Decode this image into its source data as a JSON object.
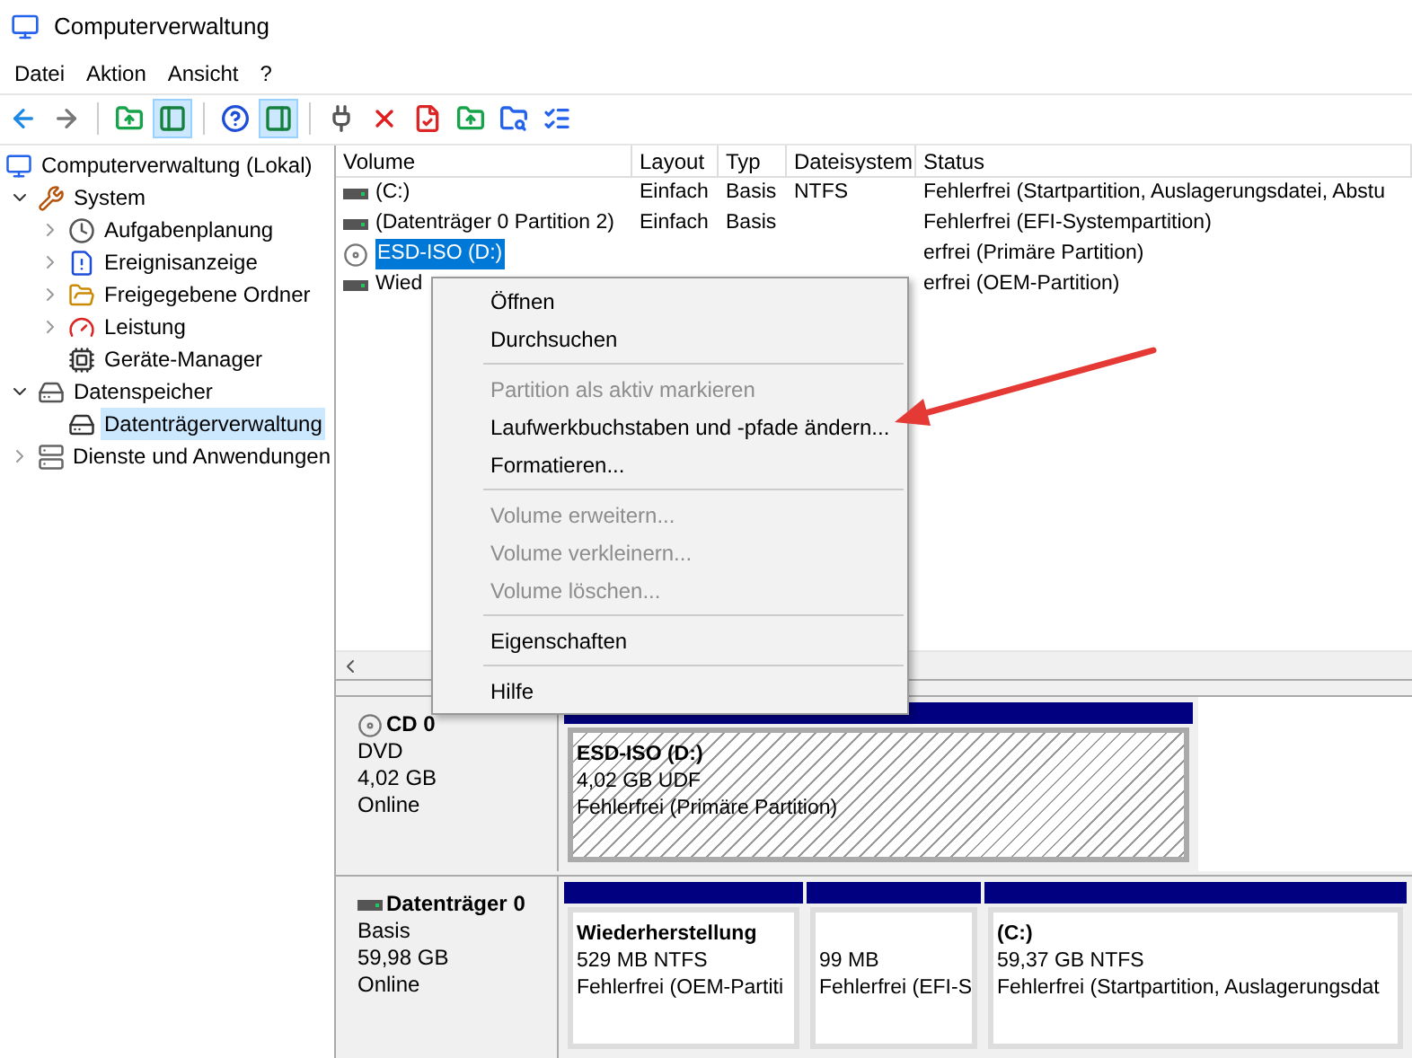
{
  "window": {
    "title": "Computerverwaltung"
  },
  "menu_bar": [
    "Datei",
    "Aktion",
    "Ansicht",
    "?"
  ],
  "toolbar": [
    {
      "kind": "back",
      "pressed": false
    },
    {
      "kind": "forward",
      "pressed": false
    },
    {
      "kind": "separator"
    },
    {
      "kind": "up",
      "pressed": false
    },
    {
      "kind": "tree-toggle",
      "pressed": true
    },
    {
      "kind": "separator"
    },
    {
      "kind": "help",
      "pressed": false
    },
    {
      "kind": "action-toggle",
      "pressed": true
    },
    {
      "kind": "separator"
    },
    {
      "kind": "connect",
      "pressed": false
    },
    {
      "kind": "delete",
      "pressed": false
    },
    {
      "kind": "properties",
      "pressed": false
    },
    {
      "kind": "export",
      "pressed": false
    },
    {
      "kind": "find",
      "pressed": false
    },
    {
      "kind": "list",
      "pressed": false
    }
  ],
  "tree": [
    {
      "label": "Computerverwaltung (Lokal)",
      "selected": false,
      "children": [
        {
          "label": "System",
          "expanded": true,
          "selected": false,
          "children": [
            {
              "label": "Aufgabenplanung",
              "expanded": false,
              "selected": false
            },
            {
              "label": "Ereignisanzeige",
              "expanded": false,
              "selected": false
            },
            {
              "label": "Freigegebene Ordner",
              "expanded": false,
              "selected": false
            },
            {
              "label": "Leistung",
              "expanded": false,
              "selected": false
            },
            {
              "label": "Geräte-Manager",
              "selected": false
            }
          ]
        },
        {
          "label": "Datenspeicher",
          "expanded": true,
          "selected": false,
          "children": [
            {
              "label": "Datenträgerverwaltung",
              "selected": true
            }
          ]
        },
        {
          "label": "Dienste und Anwendungen",
          "expanded": false,
          "selected": false
        }
      ]
    }
  ],
  "volume_table": {
    "columns": [
      "Volume",
      "Layout",
      "Typ",
      "Dateisystem",
      "Status"
    ],
    "rows": [
      {
        "kind": "drive",
        "selected": false,
        "cells": [
          "(C:)",
          "Einfach",
          "Basis",
          "NTFS",
          "Fehlerfrei (Startpartition, Auslagerungsdatei, Abstu"
        ]
      },
      {
        "kind": "drive",
        "selected": false,
        "cells": [
          "(Datenträger 0 Partition 2)",
          "Einfach",
          "Basis",
          "",
          "Fehlerfrei (EFI-Systempartition)"
        ]
      },
      {
        "kind": "disc",
        "selected": true,
        "cells": [
          "ESD-ISO (D:)",
          "",
          "",
          "",
          "erfrei (Primäre Partition)"
        ]
      },
      {
        "kind": "drive",
        "selected": false,
        "cells": [
          "Wied",
          "",
          "",
          "",
          "erfrei (OEM-Partition)"
        ]
      }
    ]
  },
  "context_menu": [
    {
      "kind": "item",
      "label": "Öffnen",
      "disabled": false
    },
    {
      "kind": "item",
      "label": "Durchsuchen",
      "disabled": false
    },
    {
      "kind": "separator"
    },
    {
      "kind": "item",
      "label": "Partition als aktiv markieren",
      "disabled": true
    },
    {
      "kind": "item",
      "label": "Laufwerkbuchstaben und -pfade ändern...",
      "disabled": false
    },
    {
      "kind": "item",
      "label": "Formatieren...",
      "disabled": false
    },
    {
      "kind": "separator"
    },
    {
      "kind": "item",
      "label": "Volume erweitern...",
      "disabled": true
    },
    {
      "kind": "item",
      "label": "Volume verkleinern...",
      "disabled": true
    },
    {
      "kind": "item",
      "label": "Volume löschen...",
      "disabled": true
    },
    {
      "kind": "separator"
    },
    {
      "kind": "item",
      "label": "Eigenschaften",
      "disabled": false
    },
    {
      "kind": "separator"
    },
    {
      "kind": "item",
      "label": "Hilfe",
      "disabled": false
    }
  ],
  "disks": [
    {
      "kind": "disc",
      "name": "CD 0",
      "type": "DVD",
      "size": "4,02 GB",
      "state": "Online",
      "partitions": [
        {
          "title": "ESD-ISO  (D:)",
          "size": "4,02 GB UDF",
          "status": "Fehlerfrei (Primäre Partition)",
          "selected": true
        }
      ]
    },
    {
      "kind": "drive",
      "name": "Datenträger 0",
      "type": "Basis",
      "size": "59,98 GB",
      "state": "Online",
      "partitions": [
        {
          "title": "Wiederherstellung",
          "size": "529 MB NTFS",
          "status": "Fehlerfrei (OEM-Partiti",
          "selected": false
        },
        {
          "size": "99 MB",
          "status": "Fehlerfrei (EFI-S",
          "selected": false
        },
        {
          "title": " (C:)",
          "size": "59,37 GB NTFS",
          "status": "Fehlerfrei (Startpartition, Auslagerungsdat",
          "selected": false
        }
      ]
    }
  ]
}
